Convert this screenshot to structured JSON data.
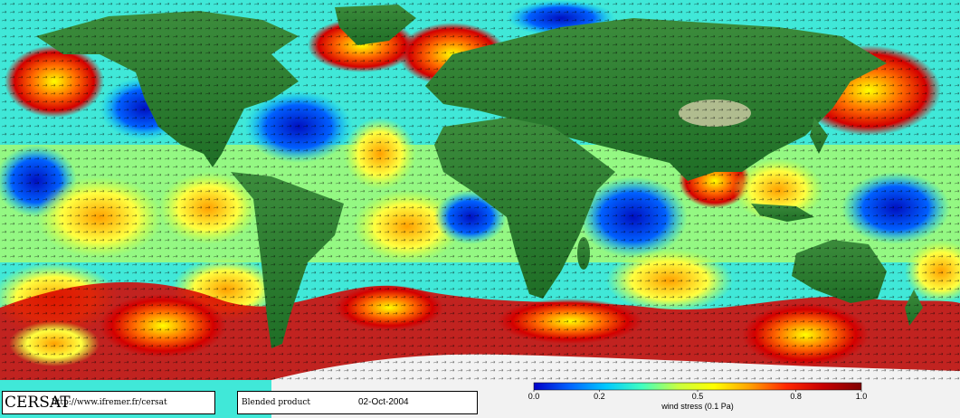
{
  "footer": {
    "brand": "CERSAT",
    "url": "http://www.ifremer.fr/cersat",
    "product": "Blended product",
    "date": "02-Oct-2004"
  },
  "colorbar": {
    "tick_labels": [
      "0.0",
      "0.2",
      "0.5",
      "0.8",
      "1.0"
    ],
    "tick_values": [
      0.0,
      0.2,
      0.5,
      0.8,
      1.0
    ],
    "label": "wind stress (0.1 Pa)",
    "range": [
      0.0,
      1.0
    ],
    "colors": [
      "#0000c8",
      "#0064ff",
      "#00c8ff",
      "#40ffc0",
      "#c8ff40",
      "#ffff00",
      "#ffa000",
      "#ff2800",
      "#c80000",
      "#800000"
    ]
  },
  "map_colors": {
    "land_low": "#2f7f2f",
    "land_high": "#c8c8a0",
    "ice": "#f2f2f2"
  }
}
